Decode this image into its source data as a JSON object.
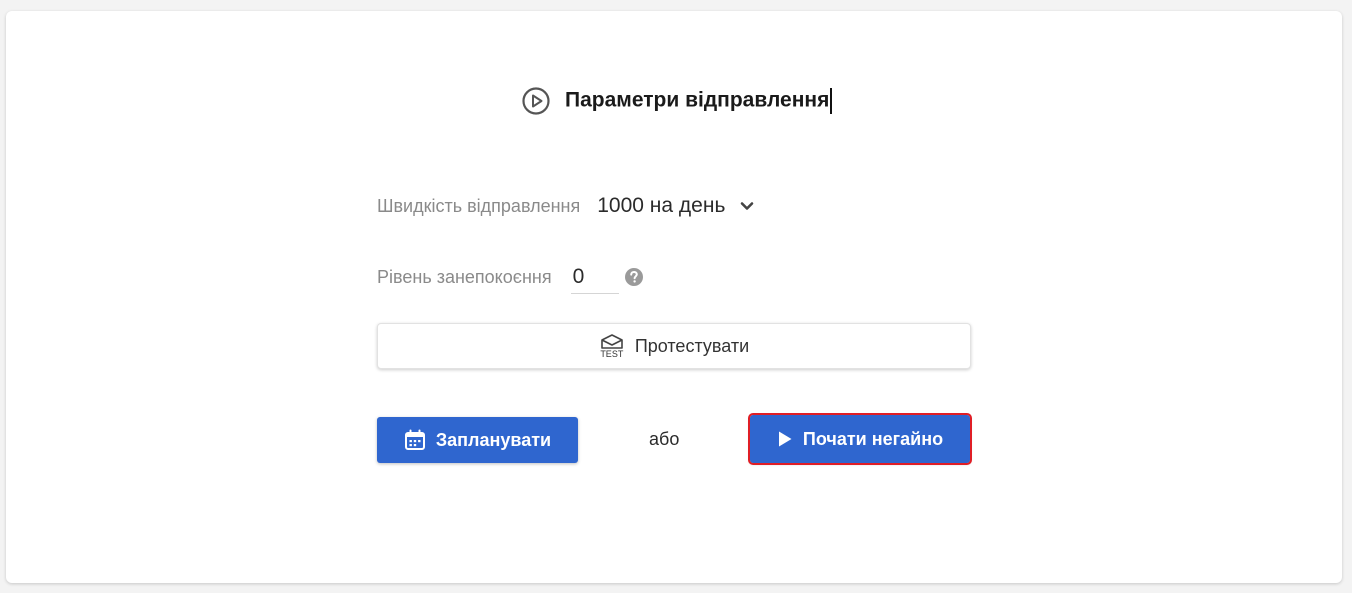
{
  "header": {
    "title": "Параметри відправлення",
    "icon": "play-circle-icon"
  },
  "speed": {
    "label": "Швидкість відправлення",
    "value": "1000 на день",
    "icon": "chevron-down-icon"
  },
  "anxiety": {
    "label": "Рівень занепокоєння",
    "value": "0",
    "help_icon": "question-circle-icon"
  },
  "test": {
    "label": "Протестувати",
    "icon_text": "TEST",
    "icon": "test-envelope-icon"
  },
  "actions": {
    "schedule_label": "Запланувати",
    "schedule_icon": "calendar-icon",
    "or_text": "або",
    "start_label": "Почати негайно",
    "start_icon": "play-icon"
  },
  "colors": {
    "primary": "#2f66cf",
    "highlight": "#e01e26",
    "muted_text": "#8a8a8a"
  }
}
